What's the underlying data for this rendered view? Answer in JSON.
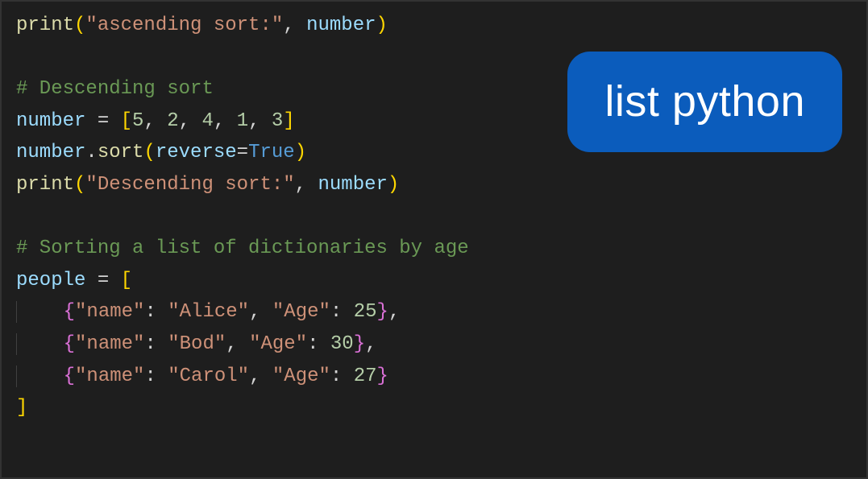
{
  "badge": {
    "text": "list python"
  },
  "code": {
    "l1_print": "print",
    "l1_str": "\"ascending sort:\"",
    "l1_arg": "number",
    "l3_comment": "# Descending sort",
    "l4_var": "number",
    "l4_nums": [
      "5",
      "2",
      "4",
      "1",
      "3"
    ],
    "l5_obj": "number",
    "l5_method": "sort",
    "l5_param": "reverse",
    "l5_val": "True",
    "l6_print": "print",
    "l6_str": "\"Descending sort:\"",
    "l6_arg": "number",
    "l8_comment": "# Sorting a list of dictionaries by age",
    "l9_var": "people",
    "k_name": "\"name\"",
    "k_age": "\"Age\"",
    "v_alice": "\"Alice\"",
    "v_bod": "\"Bod\"",
    "v_carol": "\"Carol\"",
    "n25": "25",
    "n30": "30",
    "n27": "27"
  }
}
